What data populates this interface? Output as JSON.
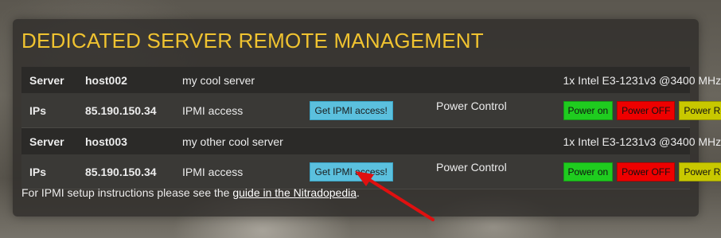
{
  "title": "DEDICATED SERVER REMOTE MANAGEMENT",
  "servers": [
    {
      "server_label": "Server",
      "hostname": "host002",
      "description": "my cool server",
      "cpu": "1x Intel E3-1231v3 @3400 MHz",
      "ips_label": "IPs",
      "ip": "85.190.150.34",
      "ipmi_label": "IPMI access",
      "ipmi_button": "Get IPMI access!",
      "power_label": "Power Control",
      "power_on": "Power on",
      "power_off": "Power OFF",
      "power_reset": "Power Reset"
    },
    {
      "server_label": "Server",
      "hostname": "host003",
      "description": "my other cool server",
      "cpu": "1x Intel E3-1231v3 @3400 MHz",
      "ips_label": "IPs",
      "ip": "85.190.150.34",
      "ipmi_label": "IPMI access",
      "ipmi_button": "Get IPMI access!",
      "power_label": "Power Control",
      "power_on": "Power on",
      "power_off": "Power OFF",
      "power_reset": "Power Reset"
    }
  ],
  "footer": {
    "text_before": "For IPMI setup instructions please see the ",
    "link_text": "guide in the Nitradopedia",
    "text_after": "."
  },
  "colors": {
    "title": "#f0c330",
    "ipmi_button": "#5bc0de",
    "power_on": "#1fcc1f",
    "power_off": "#ee0000",
    "power_reset": "#c8c800",
    "annotation_arrow": "#e01010"
  },
  "annotation": {
    "icon": "red-arrow-icon",
    "points_to": "Get IPMI access! button of host003"
  }
}
